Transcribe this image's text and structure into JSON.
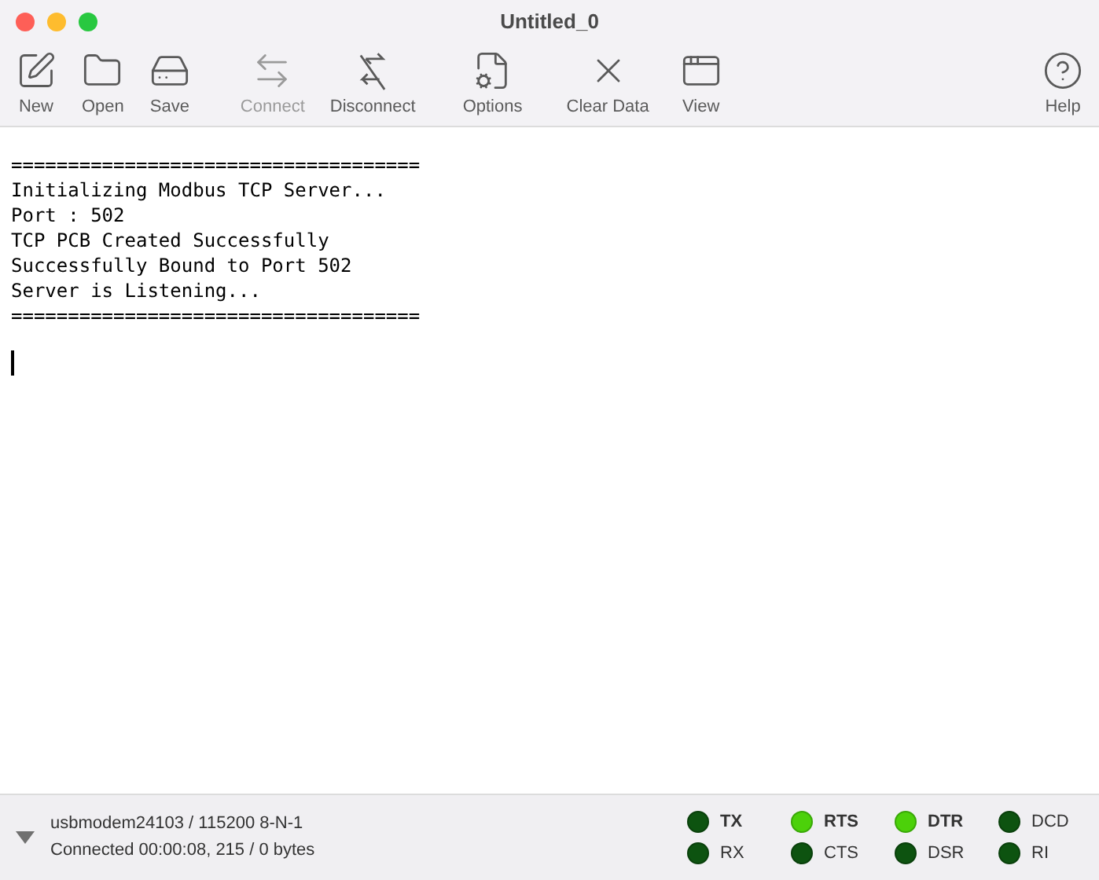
{
  "window": {
    "title": "Untitled_0"
  },
  "toolbar": [
    {
      "kind": "new",
      "label": "New",
      "disabled": false
    },
    {
      "kind": "open",
      "label": "Open",
      "disabled": false
    },
    {
      "kind": "save",
      "label": "Save",
      "disabled": false
    },
    {
      "kind": "connect",
      "label": "Connect",
      "disabled": true
    },
    {
      "kind": "disconnect",
      "label": "Disconnect",
      "disabled": false
    },
    {
      "kind": "options",
      "label": "Options",
      "disabled": false
    },
    {
      "kind": "clear",
      "label": "Clear Data",
      "disabled": false
    },
    {
      "kind": "view",
      "label": "View",
      "disabled": false
    },
    {
      "kind": "help",
      "label": "Help",
      "disabled": false
    }
  ],
  "terminal": {
    "lines": [
      "====================================",
      "Initializing Modbus TCP Server...",
      "Port : 502",
      "TCP PCB Created Successfully",
      "Successfully Bound to Port 502",
      "Server is Listening...",
      "===================================="
    ]
  },
  "status_bar": {
    "port": "usbmodem24103 / 115200 8-N-1",
    "connection": "Connected 00:00:08, 215 / 0 bytes",
    "signals": [
      {
        "label": "TX",
        "on": false,
        "kind": "output"
      },
      {
        "label": "RX",
        "on": false,
        "kind": "input"
      },
      {
        "label": "RTS",
        "on": true,
        "kind": "output"
      },
      {
        "label": "CTS",
        "on": false,
        "kind": "input"
      },
      {
        "label": "DTR",
        "on": true,
        "kind": "output"
      },
      {
        "label": "DSR",
        "on": false,
        "kind": "input"
      },
      {
        "label": "DCD",
        "on": false,
        "kind": "input"
      },
      {
        "label": "RI",
        "on": false,
        "kind": "input"
      }
    ]
  }
}
